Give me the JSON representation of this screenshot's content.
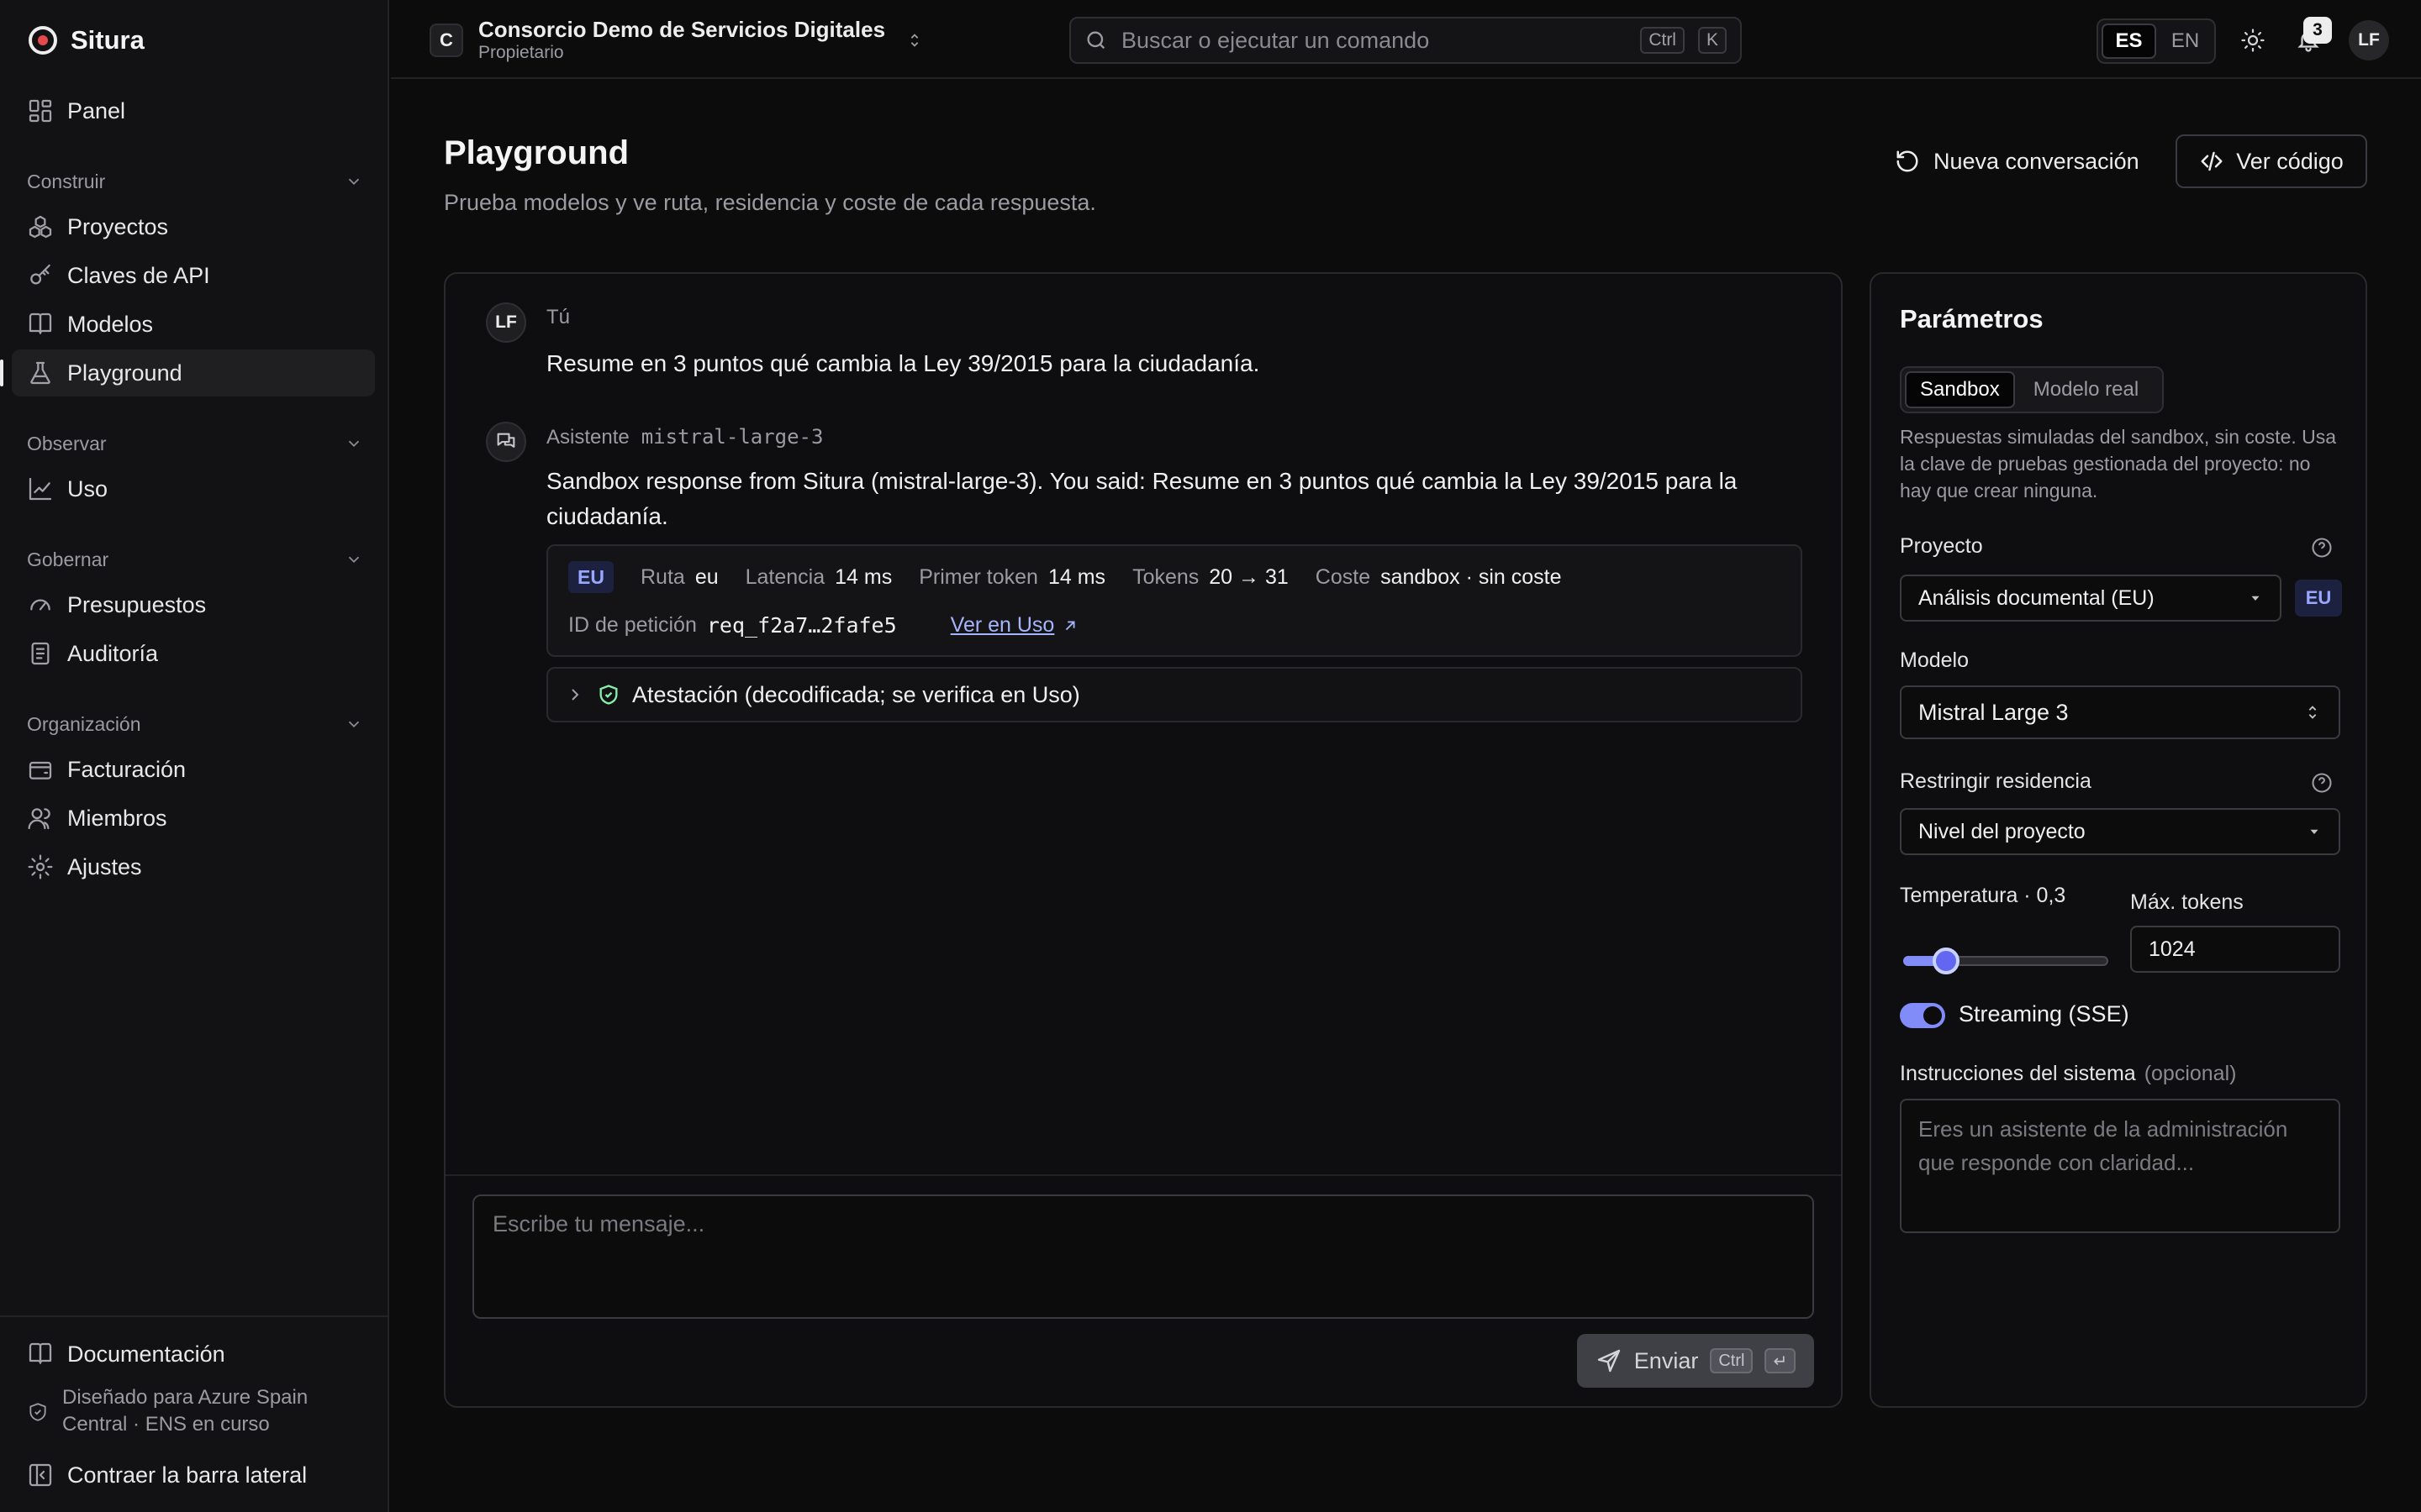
{
  "app": {
    "name": "Situra"
  },
  "sidebar": {
    "panel": "Panel",
    "sections": [
      {
        "label": "Construir",
        "items": [
          "Proyectos",
          "Claves de API",
          "Modelos",
          "Playground"
        ]
      },
      {
        "label": "Observar",
        "items": [
          "Uso"
        ]
      },
      {
        "label": "Gobernar",
        "items": [
          "Presupuestos",
          "Auditoría"
        ]
      },
      {
        "label": "Organización",
        "items": [
          "Facturación",
          "Miembros",
          "Ajustes"
        ]
      }
    ],
    "active": "Playground",
    "docs": "Documentación",
    "region_note": "Diseñado para Azure Spain Central · ENS en curso",
    "collapse": "Contraer la barra lateral"
  },
  "topbar": {
    "org_initial": "C",
    "org_name": "Consorcio Demo de Servicios Digitales",
    "org_role": "Propietario",
    "search_placeholder": "Buscar o ejecutar un comando",
    "search_kbd": [
      "Ctrl",
      "K"
    ],
    "languages": [
      "ES",
      "EN"
    ],
    "active_language": "ES",
    "notifications_count": "3",
    "user_initials": "LF"
  },
  "page": {
    "title": "Playground",
    "subtitle": "Prueba modelos y ve ruta, residencia y coste de cada respuesta.",
    "new_conversation": "Nueva conversación",
    "view_code": "Ver código"
  },
  "chat": {
    "user": {
      "avatar": "LF",
      "name": "Tú",
      "text": "Resume en 3 puntos qué cambia la Ley 39/2015 para la ciudadanía."
    },
    "assistant": {
      "name": "Asistente",
      "model": "mistral-large-3",
      "text": "Sandbox response from Situra (mistral-large-3). You said: Resume en 3 puntos qué cambia la Ley 39/2015 para la ciudadanía."
    },
    "meta": {
      "region_badge": "EU",
      "route_label": "Ruta",
      "route_value": "eu",
      "latency_label": "Latencia",
      "latency_value": "14 ms",
      "first_token_label": "Primer token",
      "first_token_value": "14 ms",
      "tokens_label": "Tokens",
      "tokens_value": "20 → 31",
      "cost_label": "Coste",
      "cost_value": "sandbox · sin coste",
      "request_id_label": "ID de petición",
      "request_id_value": "req_f2a7…2fafe5",
      "usage_link": "Ver en Uso"
    },
    "attestation": "Atestación (decodificada; se verifica en Uso)",
    "composer_placeholder": "Escribe tu mensaje...",
    "send_label": "Enviar",
    "send_kbd": [
      "Ctrl",
      "↵"
    ]
  },
  "params": {
    "title": "Parámetros",
    "modes": [
      "Sandbox",
      "Modelo real"
    ],
    "active_mode": "Sandbox",
    "mode_hint": "Respuestas simuladas del sandbox, sin coste. Usa la clave de pruebas gestionada del proyecto: no hay que crear ninguna.",
    "project_label": "Proyecto",
    "project_value": "Análisis documental (EU)",
    "project_region": "EU",
    "model_label": "Modelo",
    "model_value": "Mistral Large 3",
    "residency_label": "Restringir residencia",
    "residency_value": "Nivel del proyecto",
    "temperature_label": "Temperatura · 0,3",
    "temperature_value": 0.3,
    "max_tokens_label": "Máx. tokens",
    "max_tokens_value": "1024",
    "streaming_label": "Streaming (SSE)",
    "streaming_on": true,
    "system_label": "Instrucciones del sistema",
    "system_optional": "(opcional)",
    "system_placeholder": "Eres un asistente de la administración que responde con claridad..."
  },
  "colors": {
    "background": "#0c0c0d",
    "sidebar": "#121214",
    "accent": "#818cf8",
    "eu_badge_text": "#9aa7ff",
    "brand_dot": "#e5484d",
    "link": "#a5b4fc"
  }
}
